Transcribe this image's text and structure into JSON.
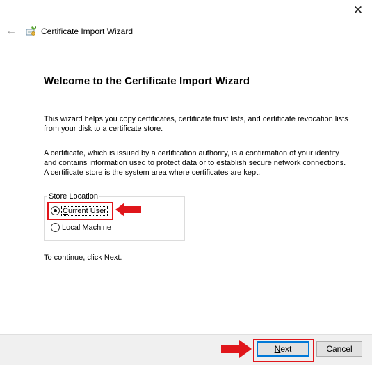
{
  "window": {
    "close_icon": "close-icon",
    "close_glyph": "✕",
    "back_icon": "back-arrow-icon",
    "back_glyph": "←",
    "title_icon": "certificate-icon",
    "title": "Certificate Import Wizard"
  },
  "content": {
    "heading": "Welcome to the Certificate Import Wizard",
    "paragraph1": "This wizard helps you copy certificates, certificate trust lists, and certificate revocation lists from your disk to a certificate store.",
    "paragraph2": "A certificate, which is issued by a certification authority, is a confirmation of your identity and contains information used to protect data or to establish secure network connections. A certificate store is the system area where certificates are kept.",
    "store_location": {
      "legend": "Store Location",
      "options": [
        {
          "label_prefix": "C",
          "label_rest": "urrent User",
          "selected": true
        },
        {
          "label_prefix": "L",
          "label_rest": "ocal Machine",
          "selected": false
        }
      ]
    },
    "continue_text": "To continue, click Next."
  },
  "footer": {
    "next_prefix": "N",
    "next_rest": "ext",
    "cancel_label": "Cancel"
  },
  "colors": {
    "highlight": "#e0161b",
    "focus_border": "#0078d7",
    "footer_bg": "#f0f0f0"
  }
}
